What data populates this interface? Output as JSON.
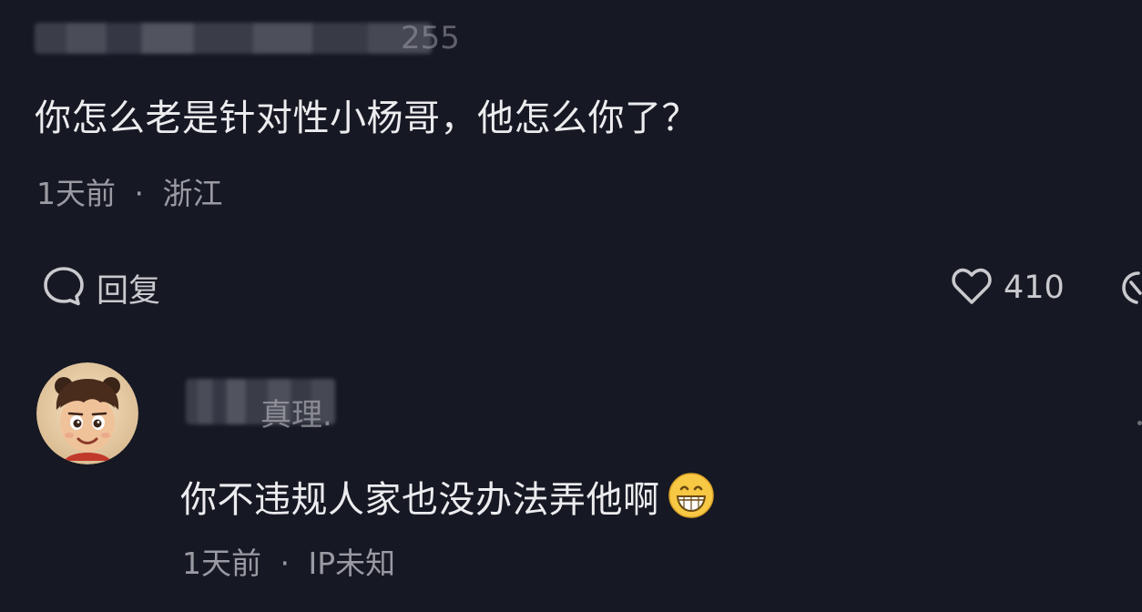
{
  "comments": [
    {
      "username_visible_fragment": "255",
      "text": "你怎么老是针对性小杨哥，他怎么你了？",
      "time": "1天前",
      "separator": "·",
      "location": "浙江",
      "reply_label": "回复",
      "like_count": "410"
    },
    {
      "username_visible_fragment": "真理.",
      "text": "你不违规人家也没办法弄他啊",
      "emoji_icon": "grinning-face-emoji",
      "time": "1天前",
      "separator": "·",
      "location": "IP未知"
    }
  ],
  "colors": {
    "background": "#161823",
    "text_primary": "#ececef",
    "text_secondary": "#9a9aa2"
  },
  "icons": {
    "reply": "speech-bubble-icon",
    "like": "heart-outline-icon"
  }
}
